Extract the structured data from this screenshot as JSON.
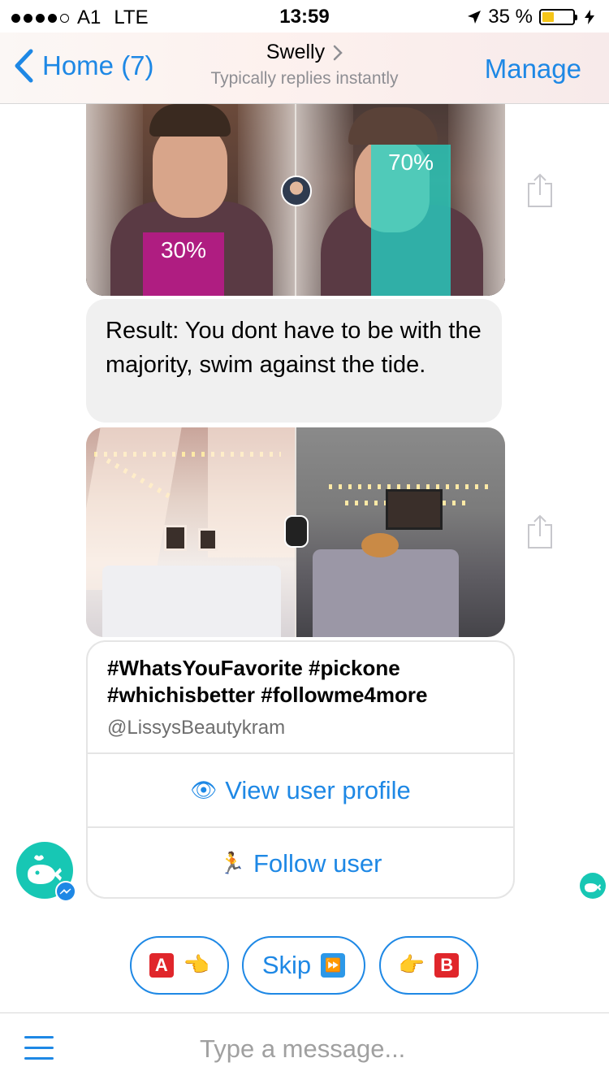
{
  "status_bar": {
    "carrier": "A1",
    "network": "LTE",
    "time": "13:59",
    "battery": "35 %",
    "battery_level": 0.35,
    "icons": [
      "signal-dots-icon",
      "location-arrow-icon",
      "battery-icon",
      "charging-bolt-icon"
    ]
  },
  "nav": {
    "back_label": "Home (7)",
    "title": "Swelly",
    "subtitle": "Typically replies instantly",
    "manage_label": "Manage"
  },
  "messages": {
    "image1": {
      "left_percent": "30%",
      "right_percent": "70%"
    },
    "result_text": "Result: You dont have to be with the majority, swim against the tide.",
    "card": {
      "tags_line1": "#WhatsYouFavorite #pickone",
      "tags_line2": "#whichisbetter #followme4more",
      "handle": "@LissysBeautykram",
      "view_profile_emoji": "👁",
      "view_profile_label": "View user profile",
      "follow_emoji": "🏃",
      "follow_label": "Follow user"
    }
  },
  "quick_replies": {
    "a_letter": "A",
    "a_hand": "👈",
    "skip_label": "Skip",
    "skip_icon": "⏩",
    "b_hand": "👉",
    "b_letter": "B"
  },
  "composer": {
    "placeholder": "Type a message..."
  },
  "colors": {
    "accent": "#1e88e5",
    "bot": "#17c7b4",
    "magenta": "#be198c",
    "teal_overlay": "#23d7c8"
  }
}
